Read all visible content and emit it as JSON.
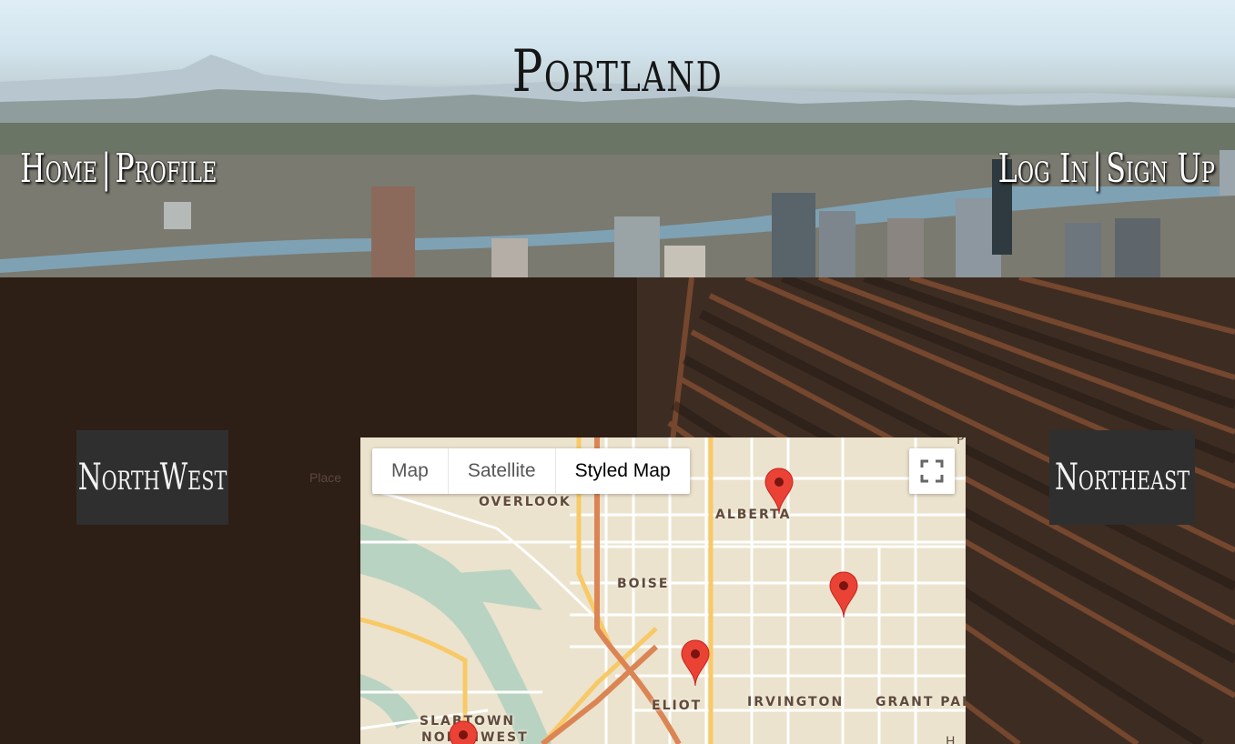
{
  "header": {
    "title": "Portland",
    "nav_left": {
      "home": "Home",
      "separator": "|",
      "profile": "Profile"
    },
    "nav_right": {
      "login": "Log In",
      "separator": "|",
      "signup": "Sign Up"
    }
  },
  "regions": {
    "left": "NorthWest",
    "right": "Northeast"
  },
  "map": {
    "type_options": [
      "Map",
      "Satellite",
      "Styled Map"
    ],
    "selected_type": "Styled Map",
    "labels": {
      "overlook": "OVERLOOK",
      "alberta": "ALBERTA",
      "boise": "BOISE",
      "eliot": "ELIOT",
      "irvington": "IRVINGTON",
      "grant_park": "GRANT PAR",
      "slabtown": "SLABTOWN",
      "northwest": "NORTHWEST",
      "edge_p": "P",
      "edge_h": "H"
    },
    "colors": {
      "land": "#ebe3cd",
      "water": "#b9d3c2",
      "highway": "#f8c967",
      "freeway": "#db8555",
      "marker": "#ea4335"
    }
  },
  "ghost_text": "Place"
}
